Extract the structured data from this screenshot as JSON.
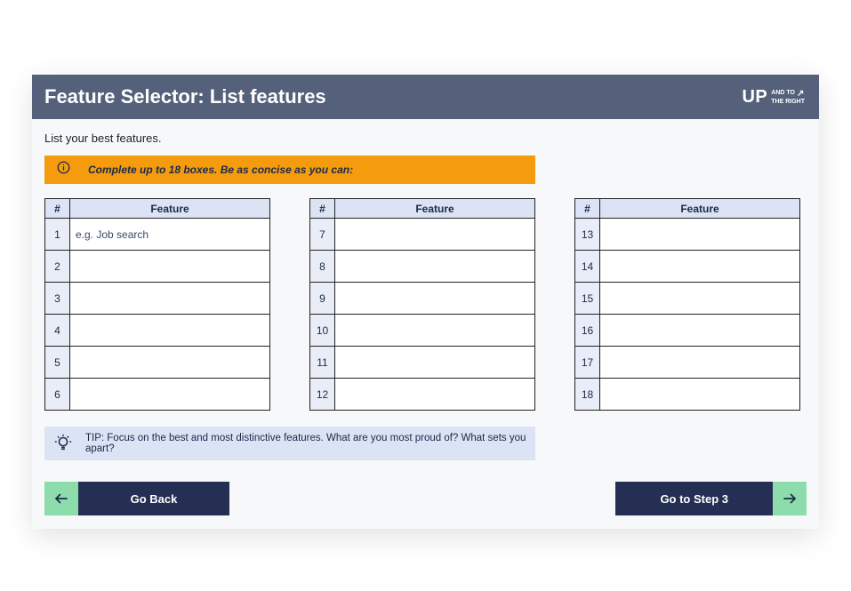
{
  "header": {
    "title": "Feature Selector: List features",
    "logo_top": "UP",
    "logo_line1": "AND TO",
    "logo_line2": "THE RIGHT"
  },
  "intro_text": "List your best features.",
  "notice_text": "Complete up to 18 boxes. Be as concise as you can:",
  "table": {
    "num_header": "#",
    "feature_header": "Feature",
    "row1_placeholder": "e.g. Job search",
    "columns": [
      {
        "start": 1,
        "rows": [
          {
            "n": "1",
            "v": "",
            "ph": "e.g. Job search"
          },
          {
            "n": "2",
            "v": ""
          },
          {
            "n": "3",
            "v": ""
          },
          {
            "n": "4",
            "v": ""
          },
          {
            "n": "5",
            "v": ""
          },
          {
            "n": "6",
            "v": ""
          }
        ]
      },
      {
        "start": 7,
        "rows": [
          {
            "n": "7",
            "v": ""
          },
          {
            "n": "8",
            "v": ""
          },
          {
            "n": "9",
            "v": ""
          },
          {
            "n": "10",
            "v": ""
          },
          {
            "n": "11",
            "v": ""
          },
          {
            "n": "12",
            "v": ""
          }
        ]
      },
      {
        "start": 13,
        "rows": [
          {
            "n": "13",
            "v": ""
          },
          {
            "n": "14",
            "v": ""
          },
          {
            "n": "15",
            "v": ""
          },
          {
            "n": "16",
            "v": ""
          },
          {
            "n": "17",
            "v": ""
          },
          {
            "n": "18",
            "v": ""
          }
        ]
      }
    ]
  },
  "tip_text": "TIP: Focus on the best and most distinctive features. What are you most proud of? What sets you apart?",
  "footer": {
    "back_label": "Go Back",
    "next_label": "Go to Step 3"
  }
}
